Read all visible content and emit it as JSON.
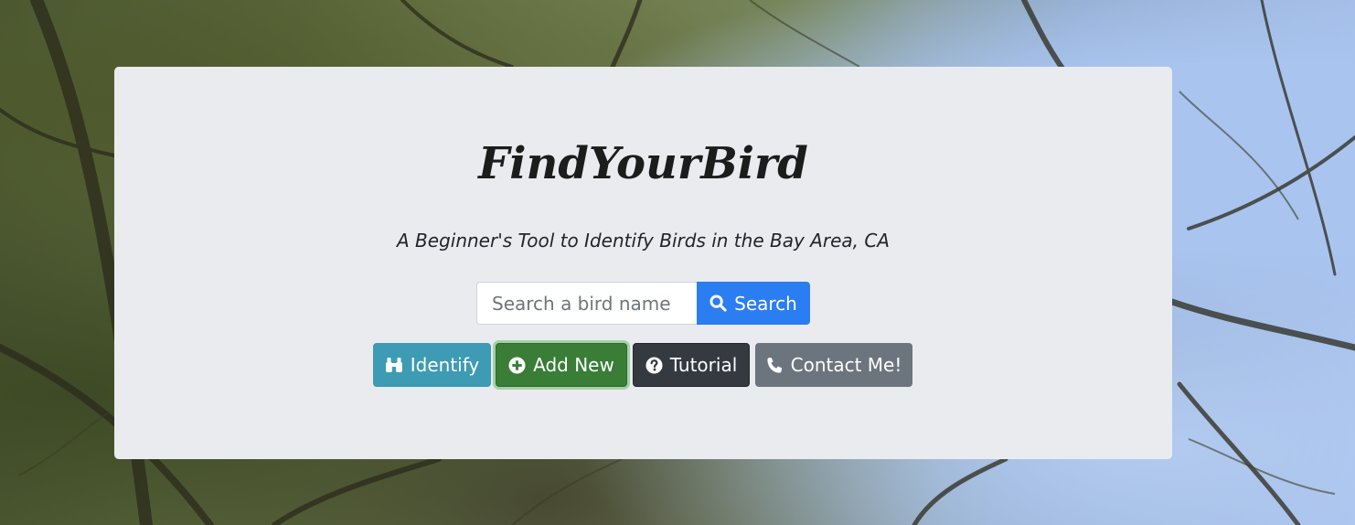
{
  "app": {
    "title": "FindYourBird",
    "subtitle": "A Beginner's Tool to Identify Birds in the Bay Area, CA"
  },
  "search": {
    "placeholder": "Search a bird name",
    "value": "",
    "button_label": "Search",
    "button_icon": "search-icon"
  },
  "actions": [
    {
      "label": "Identify",
      "icon": "binoculars-icon",
      "color": "#3d9bb3"
    },
    {
      "label": "Add New",
      "icon": "plus-circle-icon",
      "color": "#3a7d36"
    },
    {
      "label": "Tutorial",
      "icon": "question-circle-icon",
      "color": "#343a40"
    },
    {
      "label": "Contact Me!",
      "icon": "phone-icon",
      "color": "#6c757d"
    }
  ],
  "colors": {
    "panel_background": "#e9ebef",
    "primary": "#2b7df2"
  }
}
